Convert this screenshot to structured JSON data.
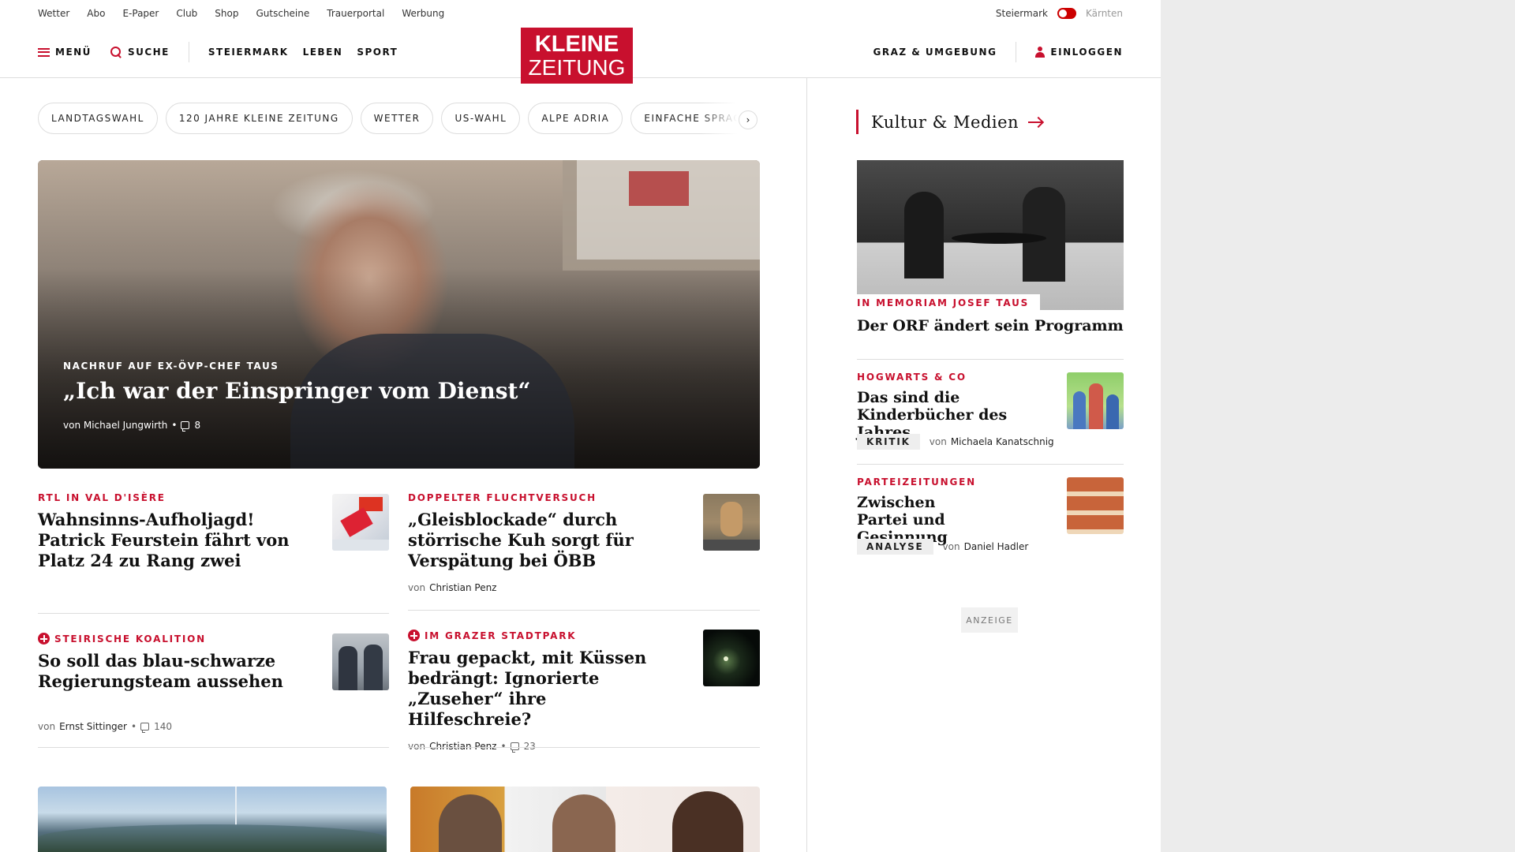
{
  "topbar": {
    "links": [
      "Wetter",
      "Abo",
      "E-Paper",
      "Club",
      "Shop",
      "Gutscheine",
      "Trauerportal",
      "Werbung"
    ],
    "region_active": "Steiermark",
    "region_inactive": "Kärnten"
  },
  "header": {
    "menu_label": "MENÜ",
    "search_label": "SUCHE",
    "nav": [
      "STEIERMARK",
      "LEBEN",
      "SPORT"
    ],
    "logo_line1": "KLEINE",
    "logo_line2": "ZEITUNG",
    "region_link": "GRAZ & UMGEBUNG",
    "login_label": "EINLOGGEN"
  },
  "chips": [
    "LANDTAGSWAHL",
    "120 JAHRE KLEINE ZEITUNG",
    "WETTER",
    "US-WAHL",
    "ALPE ADRIA",
    "EINFACHE SPRACHE"
  ],
  "hero": {
    "kicker": "NACHRUF AUF EX-ÖVP-CHEF TAUS",
    "title": "„Ich war der Einspringer vom Dienst“",
    "author": "von Michael Jungwirth",
    "comments": "8"
  },
  "articles": [
    {
      "kicker": "RTL IN VAL D'ISÈRE",
      "title": "Wahnsinns-Aufholjagd! Patrick Feurstein fährt von Platz 24 zu Rang zwei",
      "plus": false
    },
    {
      "kicker": "DOPPELTER FLUCHTVERSUCH",
      "title": "„Gleisblockade“ durch störrische Kuh sorgt für Verspätung bei ÖBB",
      "byline_prefix": "von",
      "author": "Christian Penz",
      "plus": false
    },
    {
      "kicker": "STEIRISCHE KOALITION",
      "title": "So soll das blau-schwarze Regierungsteam aussehen",
      "byline_prefix": "von",
      "author": "Ernst Sittinger",
      "comments": "140",
      "plus": true
    },
    {
      "kicker": "IM GRAZER STADTPARK",
      "title": "Frau gepackt, mit Küssen bedrängt: Ignorierte „Zuseher“ ihre Hilfeschreie?",
      "byline_prefix": "von",
      "author": "Christian Penz",
      "comments": "23",
      "plus": true
    }
  ],
  "sidebar": {
    "section_title": "Kultur & Medien",
    "main": {
      "kicker": "IN MEMORIAM JOSEF TAUS",
      "title": "Der ORF ändert sein Programm"
    },
    "items": [
      {
        "kicker": "HOGWARTS & CO",
        "title": "Das sind die Kinderbücher des Jahres",
        "label": "KRITIK",
        "byline_prefix": "von",
        "author": "Michaela Kanatschnig"
      },
      {
        "kicker": "PARTEIZEITUNGEN",
        "title": "Zwischen Partei und Gesinnung",
        "label": "ANALYSE",
        "byline_prefix": "von",
        "author": "Daniel Hadler"
      }
    ],
    "ad_label": "ANZEIGE"
  },
  "colors": {
    "brand_red": "#c8102e",
    "divider": "#dddddd",
    "outer_background": "#ececec"
  }
}
